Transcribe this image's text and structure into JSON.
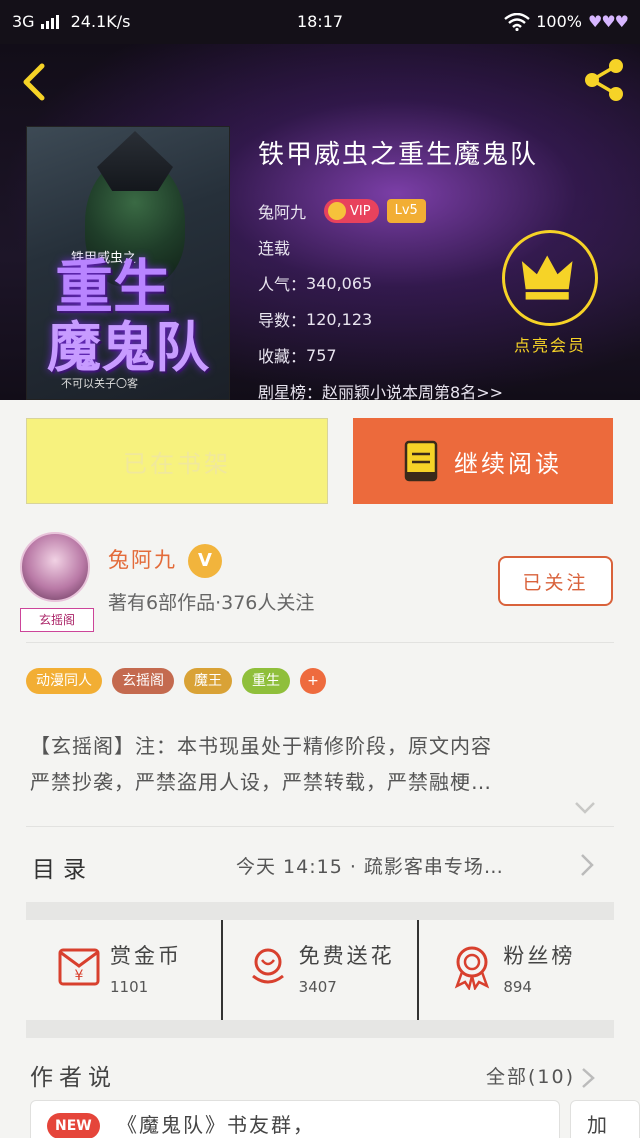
{
  "status_bar": {
    "network": "3G",
    "speed": "24.1K/s",
    "time": "18:17",
    "battery": "100%"
  },
  "book": {
    "title": "铁甲威虫之重生魔鬼队",
    "author": "兔阿九",
    "vip_label": "VIP",
    "level_label": "Lv5",
    "status": "连载",
    "popularity_label": "人气",
    "popularity": "340,065",
    "fans_label": "导数",
    "fans": "120,123",
    "favorites_label": "收藏",
    "favorites": "757",
    "ranking_label": "剧星榜",
    "ranking_text": "赵丽颖小说本周第8名>>",
    "member_label": "点亮会员",
    "cover_subtitle": "铁甲威虫之",
    "cover_title_line1": "重生",
    "cover_title_line2": "魔鬼队",
    "cover_small": "不可以关子〇客"
  },
  "actions": {
    "shelf_label": "已在书架",
    "read_label": "继续阅读"
  },
  "author_info": {
    "name": "兔阿九",
    "verified_label": "V",
    "meta": "著有6部作品·376人关注",
    "avatar_tag": "玄摇阁",
    "follow_label": "已关注"
  },
  "tags": [
    {
      "label": "动漫同人",
      "color": "#f2ae34"
    },
    {
      "label": "玄摇阁",
      "color": "#c46a4f"
    },
    {
      "label": "魔王",
      "color": "#d9a236"
    },
    {
      "label": "重生",
      "color": "#8fbf3b"
    }
  ],
  "tag_more": "+",
  "description": {
    "line1": "【玄摇阁】注：本书现虽处于精修阶段，原文内容",
    "line2": "严禁抄袭，严禁盗用人设，严禁转载，严禁融梗…"
  },
  "toc": {
    "label": "目录",
    "latest": "今天 14:15 · 疏影客串专场…"
  },
  "stats": [
    {
      "name": "赏金币",
      "value": "1101",
      "icon": "red-envelope-icon"
    },
    {
      "name": "免费送花",
      "value": "3407",
      "icon": "flower-icon"
    },
    {
      "name": "粉丝榜",
      "value": "894",
      "icon": "medal-icon"
    }
  ],
  "author_says": {
    "title": "作者说",
    "all_label": "全部(10)",
    "new_badge": "NEW",
    "first_post": "《魔鬼队》书友群，",
    "second_post_partial": "加"
  },
  "colors": {
    "accent_orange": "#ec6a3c",
    "shelf_yellow": "#f7f27e",
    "gold": "#f6d327",
    "vip_red": "#e8425d"
  }
}
